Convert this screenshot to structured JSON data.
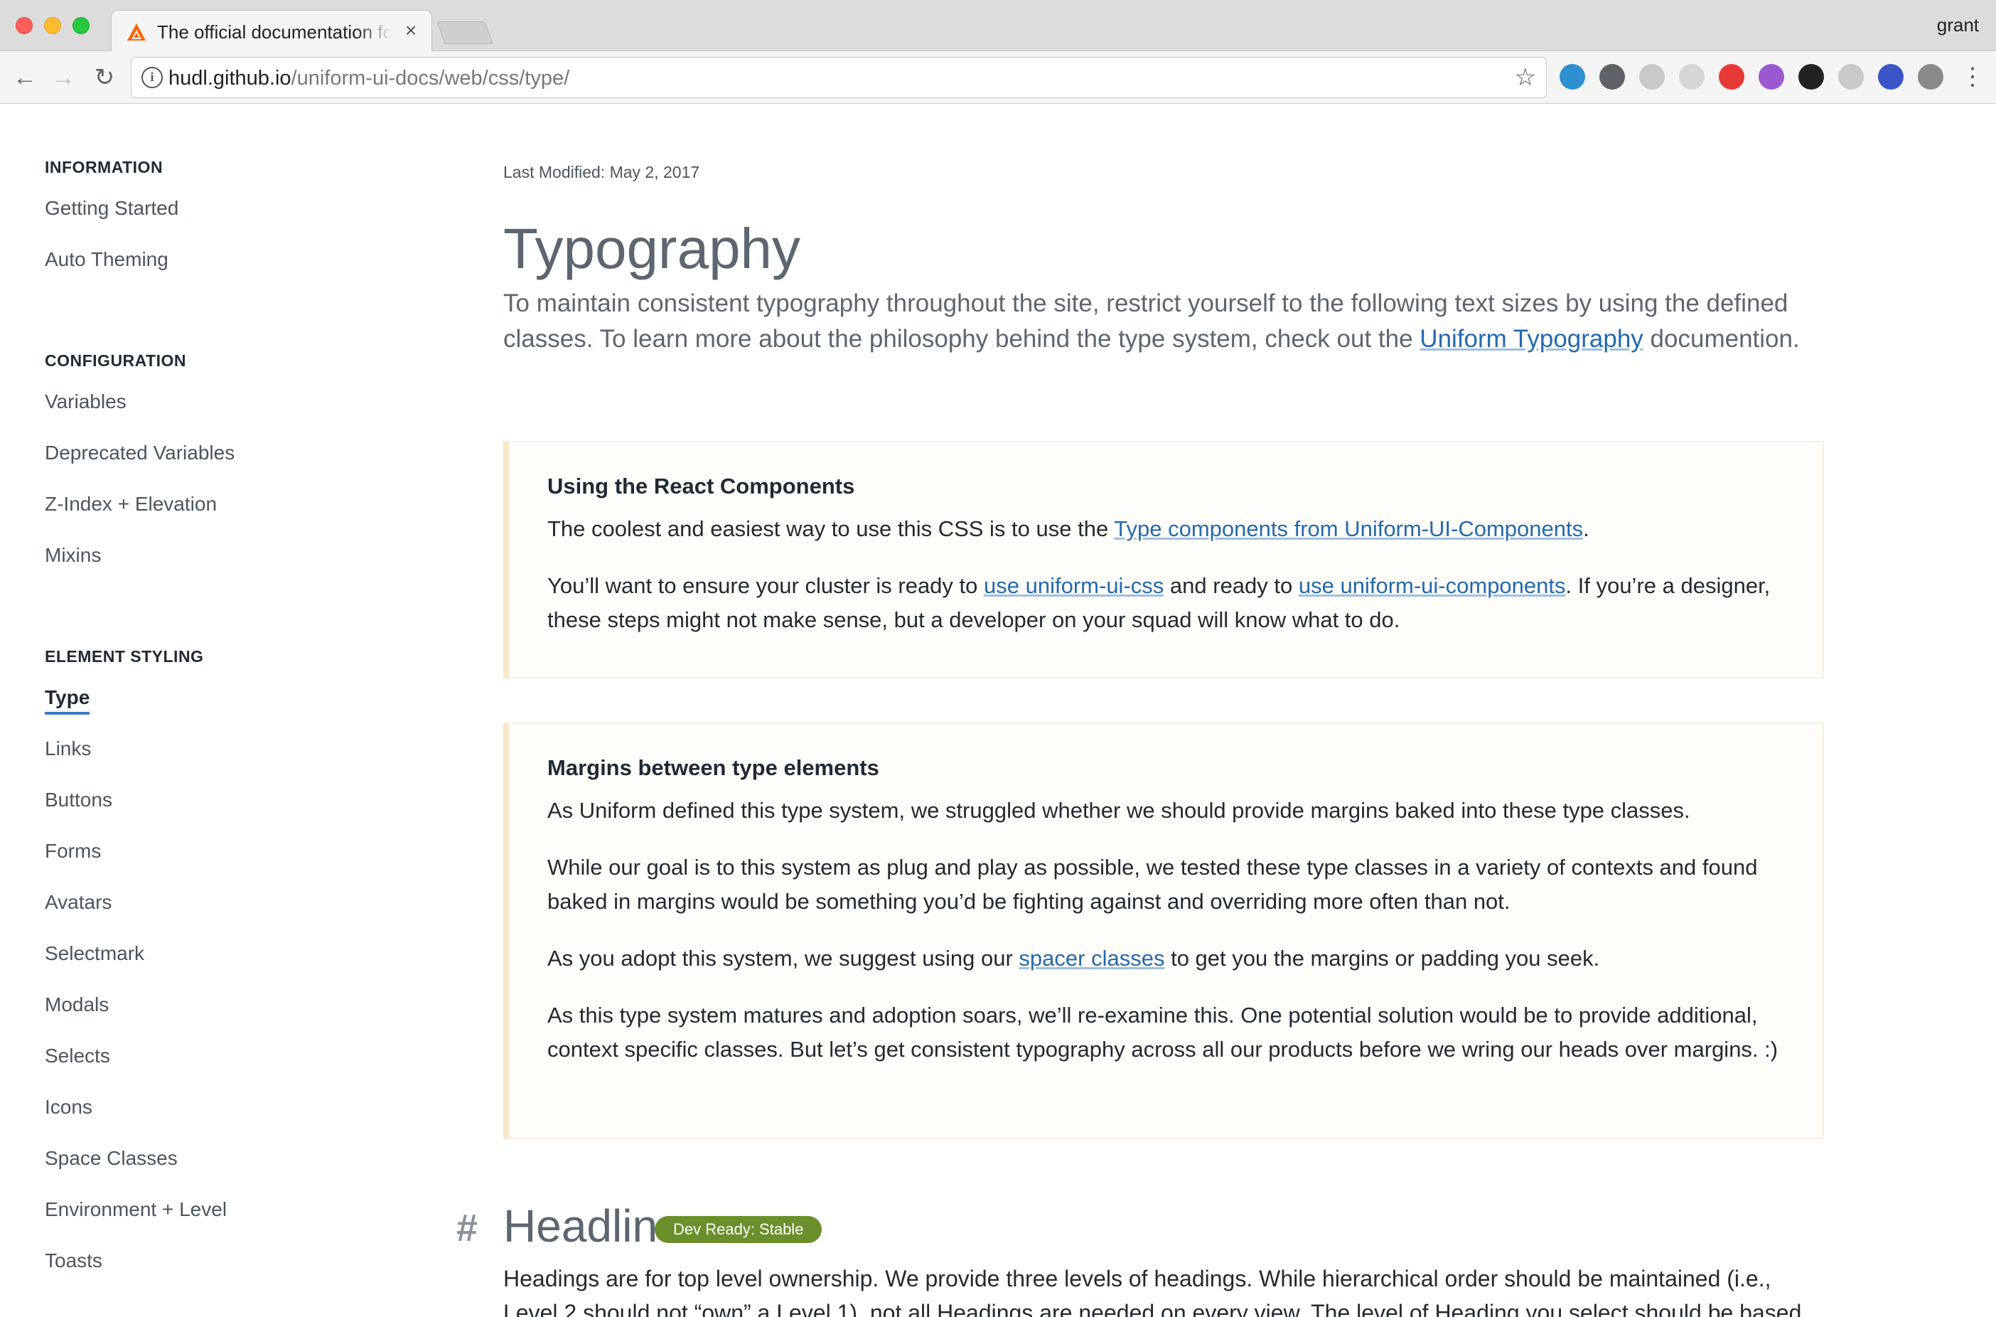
{
  "browser": {
    "tab_title": "The official documentation for Uniform",
    "tab_close": "×",
    "profile": "grant",
    "url_host": "hudl.github.io",
    "url_path": "/uniform-ui-docs/web/css/type/",
    "info_glyph": "i",
    "star_glyph": "☆",
    "back_glyph": "←",
    "forward_glyph": "→",
    "reload_glyph": "↻",
    "menu_glyph": "⋮",
    "extensions": [
      {
        "name": "ring-extension-icon",
        "color": "#2e8fd1"
      },
      {
        "name": "password-manager-icon",
        "color": "#5f6368"
      },
      {
        "name": "settings-extension-icon",
        "color": "#c9c9c9"
      },
      {
        "name": "grid-extension-icon",
        "color": "#d6d6d6"
      },
      {
        "name": "youtube-extension-icon",
        "color": "#e53935"
      },
      {
        "name": "paint-extension-icon",
        "color": "#9b59d0"
      },
      {
        "name": "panda-extension-icon",
        "color": "#222222"
      },
      {
        "name": "cloud-extension-icon",
        "color": "#c9c9c9"
      },
      {
        "name": "reader-extension-icon",
        "color": "#3a55c6"
      },
      {
        "name": "gear-extension-icon",
        "color": "#8a8a8a"
      }
    ]
  },
  "sidebar": {
    "sections": [
      {
        "title": "INFORMATION",
        "items": [
          "Getting Started",
          "Auto Theming"
        ]
      },
      {
        "title": "CONFIGURATION",
        "items": [
          "Variables",
          "Deprecated Variables",
          "Z-Index + Elevation",
          "Mixins"
        ]
      },
      {
        "title": "ELEMENT STYLING",
        "items": [
          "Type",
          "Links",
          "Buttons",
          "Forms",
          "Avatars",
          "Selectmark",
          "Modals",
          "Selects",
          "Icons",
          "Space Classes",
          "Environment + Level",
          "Toasts"
        ]
      }
    ],
    "active_item": "Type"
  },
  "main": {
    "last_modified_label": "Last Modified:",
    "last_modified_date": "May 2, 2017",
    "title": "Typography",
    "intro_text": "To maintain consistent typography throughout the site, restrict yourself to the following text sizes by using the defined classes. To learn more about the philosophy behind the type system, check out the",
    "intro_link": "Uniform Typography",
    "intro_end": "documention.",
    "callouts": [
      {
        "title": "Using the React Components",
        "p1_pre": "The coolest and easiest way to use this CSS is to use the",
        "p1_link": "Type components from Uniform-UI-Components",
        "p1_post": ".",
        "p2_pre": "You’ll want to ensure your cluster is ready to",
        "p2_link1": "use uniform-ui-css",
        "p2_mid": "and ready to",
        "p2_link2": "use uniform-ui-components",
        "p2_post": ". If you’re a designer, these steps might not make sense, but a developer on your squad will know what to do."
      },
      {
        "title": "Margins between type elements",
        "p1": "As Uniform defined this type system, we struggled whether we should provide margins baked into these type classes.",
        "p2": "While our goal is to this system as plug and play as possible, we tested these type classes in a variety of contexts and found baked in margins would be something you’d be fighting against and overriding more often than not.",
        "p3_pre": "As you adopt this system, we suggest using our",
        "p3_link": "spacer classes",
        "p3_post": "to get you the margins or padding you seek.",
        "p4": "As this type system matures and adoption soars, we’ll re-examine this. One potential solution would be to provide additional, context specific classes. But let’s get consistent typography across all our products before we wring our heads over margins. :)"
      }
    ],
    "headlines": {
      "hash": "#",
      "title": "Headlines",
      "badge": "Dev Ready: Stable",
      "badge_color": "#6a8f2b",
      "body": "Headings are for top level ownership. We provide three levels of headings. While hierarchical order should be maintained (i.e., Level 2 should not “own” a Level 1), not all Headings are needed on every view. The level of Heading you select should be based"
    }
  }
}
